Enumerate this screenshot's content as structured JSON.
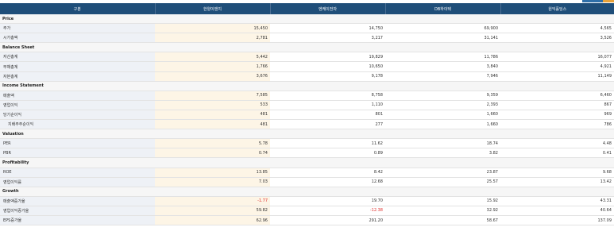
{
  "header": [
    "구분",
    "한양이앤지",
    "엔케이전자",
    "DB하이텍",
    "원익홀딩스"
  ],
  "sections": [
    {
      "title": "Price",
      "rows": [
        {
          "label": "주가",
          "values": [
            "15,450",
            "14,750",
            "69,900",
            "4,565"
          ]
        },
        {
          "label": "시가총액",
          "values": [
            "2,781",
            "3,217",
            "31,141",
            "3,526"
          ]
        }
      ]
    },
    {
      "title": "Balance Sheet",
      "rows": [
        {
          "label": "자산총계",
          "values": [
            "5,442",
            "19,829",
            "11,786",
            "16,077"
          ]
        },
        {
          "label": "부채총계",
          "values": [
            "1,766",
            "10,650",
            "3,840",
            "4,921"
          ]
        },
        {
          "label": "자본총계",
          "values": [
            "3,676",
            "9,178",
            "7,946",
            "11,149"
          ]
        }
      ]
    },
    {
      "title": "Income Statement",
      "rows": [
        {
          "label": "매출액",
          "values": [
            "7,585",
            "8,758",
            "9,359",
            "6,460"
          ]
        },
        {
          "label": "영업이익",
          "values": [
            "533",
            "1,110",
            "2,393",
            "867"
          ]
        },
        {
          "label": "당기순이익",
          "values": [
            "481",
            "801",
            "1,660",
            "969"
          ]
        },
        {
          "label": "지배주주순이익",
          "sub": true,
          "values": [
            "481",
            "277",
            "1,660",
            "786"
          ]
        }
      ]
    },
    {
      "title": "Valuation",
      "rows": [
        {
          "label": "PER",
          "values": [
            "5.78",
            "11.62",
            "18.74",
            "4.48"
          ]
        },
        {
          "label": "PBR",
          "values": [
            "0.74",
            "0.89",
            "3.82",
            "0.41"
          ]
        }
      ]
    },
    {
      "title": "Profitability",
      "rows": [
        {
          "label": "ROE",
          "values": [
            "13.85",
            "8.42",
            "23.87",
            "9.68"
          ]
        },
        {
          "label": "영업이익률",
          "values": [
            "7.03",
            "12.68",
            "25.57",
            "13.42"
          ]
        }
      ]
    },
    {
      "title": "Growth",
      "rows": [
        {
          "label": "매출액증가율",
          "values": [
            "-1.77",
            "19.70",
            "15.92",
            "43.31"
          ]
        },
        {
          "label": "영업이익증가율",
          "values": [
            "59.82",
            "-12.38",
            "32.92",
            "40.64"
          ]
        },
        {
          "label": "EPS증가율",
          "values": [
            "62.96",
            "291.20",
            "58.67",
            "137.09"
          ]
        }
      ]
    }
  ],
  "colors": {
    "header_bg": "#1f4e79",
    "highlight_bg": "#fdf5e6",
    "label_bg": "#eef1f6",
    "negative": "#e0312f"
  }
}
